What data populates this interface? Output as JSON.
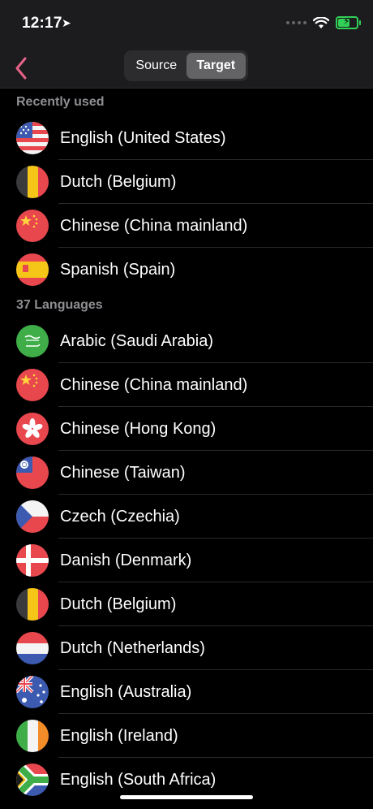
{
  "status_bar": {
    "time": "12:17"
  },
  "nav": {
    "segments": [
      {
        "label": "Source",
        "active": false
      },
      {
        "label": "Target",
        "active": true
      }
    ]
  },
  "recent": {
    "header": "Recently used",
    "items": [
      {
        "label": "English (United States)",
        "flag": "us-flag-icon"
      },
      {
        "label": "Dutch (Belgium)",
        "flag": "belgium-flag-icon"
      },
      {
        "label": "Chinese (China mainland)",
        "flag": "china-flag-icon"
      },
      {
        "label": "Spanish (Spain)",
        "flag": "spain-flag-icon"
      }
    ]
  },
  "languages": {
    "header": "37 Languages",
    "items": [
      {
        "label": "Arabic (Saudi Arabia)",
        "flag": "saudi-flag-icon"
      },
      {
        "label": "Chinese (China mainland)",
        "flag": "china-flag-icon"
      },
      {
        "label": "Chinese (Hong Kong)",
        "flag": "hongkong-flag-icon"
      },
      {
        "label": "Chinese (Taiwan)",
        "flag": "taiwan-flag-icon"
      },
      {
        "label": "Czech (Czechia)",
        "flag": "czech-flag-icon"
      },
      {
        "label": "Danish (Denmark)",
        "flag": "denmark-flag-icon"
      },
      {
        "label": "Dutch (Belgium)",
        "flag": "belgium-flag-icon"
      },
      {
        "label": "Dutch (Netherlands)",
        "flag": "netherlands-flag-icon"
      },
      {
        "label": "English (Australia)",
        "flag": "australia-flag-icon"
      },
      {
        "label": "English (Ireland)",
        "flag": "ireland-flag-icon"
      },
      {
        "label": "English (South Africa)",
        "flag": "southafrica-flag-icon"
      }
    ]
  },
  "colors": {
    "accent": "#e8628a",
    "background": "#000000",
    "header_text": "#8e8e93"
  }
}
